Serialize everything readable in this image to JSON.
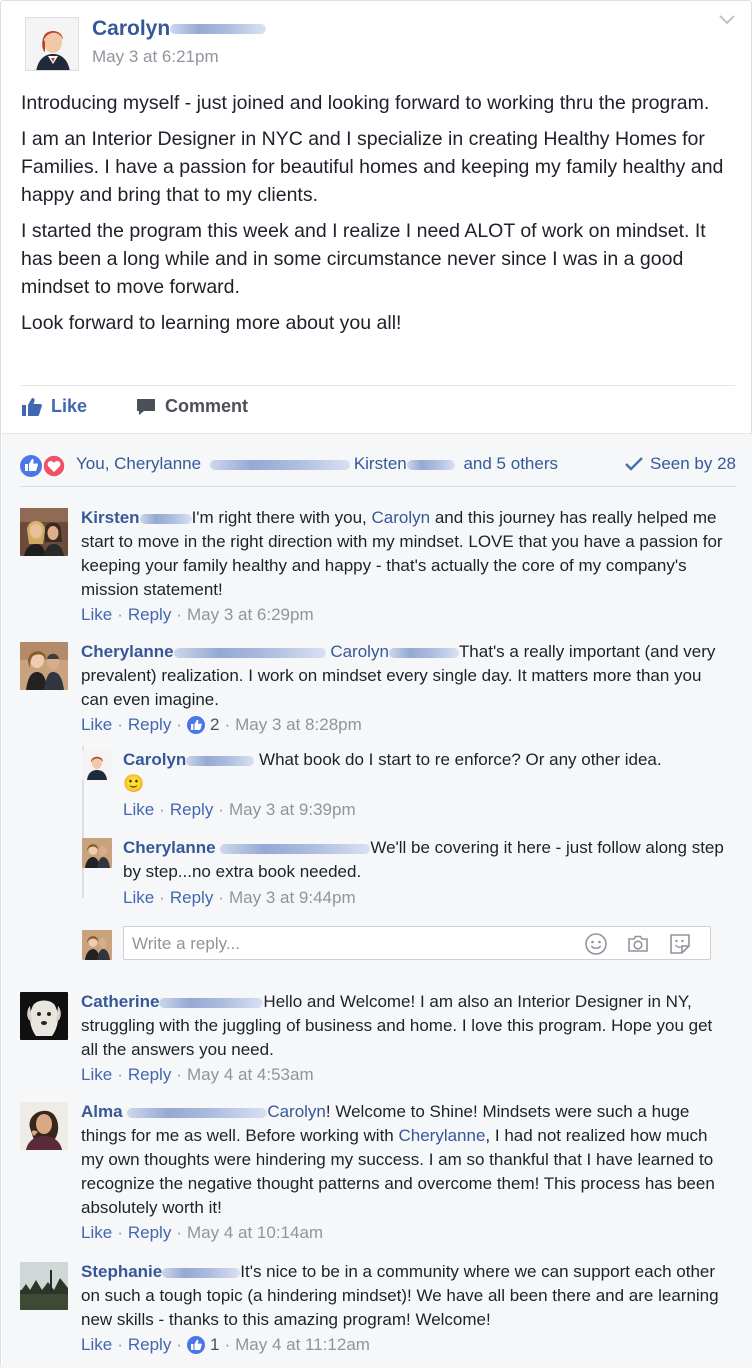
{
  "post": {
    "author": "Carolyn",
    "time": "May 3 at 6:21pm",
    "paragraphs": [
      "Introducing myself - just joined and looking forward to working thru the program.",
      "I am an Interior Designer in NYC and I specialize in creating Healthy Homes for Families. I have a passion for beautiful homes and keeping my family healthy and happy and bring that to my clients.",
      "I started the program this week and I realize I need ALOT of work on mindset. It has been a long while and in some circumstance never since I was in a good mindset to move forward.",
      "Look forward to learning more about you all!"
    ],
    "like_label": "Like",
    "comment_label": "Comment"
  },
  "reactions": {
    "text_a": "You, Cherylanne",
    "text_b": "Kirsten",
    "text_c": "and 5 others",
    "seen": "Seen by 28"
  },
  "comments": [
    {
      "name": "Kirsten",
      "text": "I'm right there with you, ",
      "mention": "Carolyn",
      "text2": " and this journey has really helped me start to move in the right direction with my mindset. LOVE that you have a passion for keeping your family healthy and happy - that's actually the core of my company's mission statement!",
      "like": "Like",
      "reply": "Reply",
      "time": "May 3 at 6:29pm"
    },
    {
      "name": "Cherylanne",
      "mention": "Carolyn",
      "text": "That's a really important (and very prevalent) realization. I work on mindset every single day. It matters more than you can even imagine.",
      "like": "Like",
      "reply": "Reply",
      "likes": "2",
      "time": "May 3 at 8:28pm"
    },
    {
      "name": "Carolyn",
      "text": "What book do I start to re enforce? Or any other idea.",
      "emoji": "🙂",
      "like": "Like",
      "reply": "Reply",
      "time": "May 3 at 9:39pm"
    },
    {
      "name": "Cherylanne",
      "text": "We'll be covering it here - just follow along step by step...no extra book needed.",
      "like": "Like",
      "reply": "Reply",
      "time": "May 3 at 9:44pm"
    },
    {
      "name": "Catherine",
      "text": "Hello and Welcome! I am also an Interior Designer in NY, struggling with the juggling of business and home. I love this program. Hope you get all the answers you need.",
      "like": "Like",
      "reply": "Reply",
      "time": "May 4 at 4:53am"
    },
    {
      "name": "Alma",
      "mention": "Carolyn",
      "text": "! Welcome to Shine! Mindsets were such a huge things for me as well. Before working with ",
      "mention2": "Cherylanne",
      "text2": ", I had not realized how much my own thoughts were hindering my success. I am so thankful that I have learned to recognize the negative thought patterns and overcome them! This process has been absolutely worth it!",
      "like": "Like",
      "reply": "Reply",
      "time": "May 4 at 10:14am"
    },
    {
      "name": "Stephanie",
      "text": "It's nice to be in a community where we can support each other on such a tough topic (a hindering mindset)! We have all been there and are learning new skills - thanks to this amazing program! Welcome!",
      "like": "Like",
      "reply": "Reply",
      "likes": "1",
      "time": "May 4 at 11:12am"
    }
  ],
  "reply_box": {
    "placeholder": "Write a reply..."
  },
  "colors": {
    "link": "#365899",
    "accent": "#4267b2",
    "meta": "#90949c",
    "love": "#f25268"
  },
  "icons": [
    "chevron-down-icon",
    "like-thumb-icon",
    "comment-bubble-icon",
    "love-heart-icon",
    "checkmark-icon",
    "emoji-icon",
    "camera-icon",
    "sticker-icon"
  ]
}
